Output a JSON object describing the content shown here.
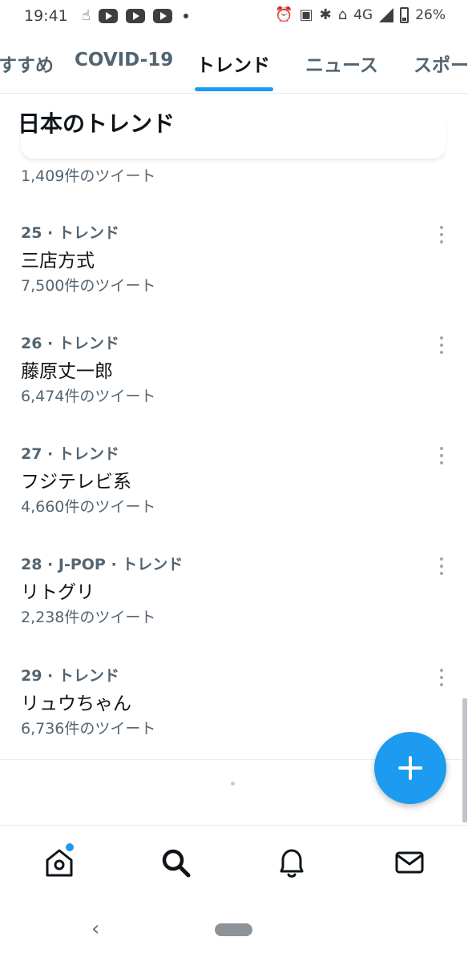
{
  "status_bar": {
    "time": "19:41",
    "network": "4G",
    "battery": "26%",
    "icons": [
      "hand-icon",
      "youtube-icon",
      "youtube-icon",
      "youtube-icon",
      "dot-icon",
      "alarm-icon",
      "nfc-icon",
      "bluetooth-icon",
      "vibrate-icon",
      "signal-icon",
      "battery-icon"
    ]
  },
  "tabs": [
    {
      "label": "すすめ"
    },
    {
      "label": "COVID-19"
    },
    {
      "label": "トレンド",
      "active": true
    },
    {
      "label": "ニュース"
    },
    {
      "label": "スポー"
    }
  ],
  "section_title": "日本のトレンド",
  "previous_item_count": "1,409件のツイート",
  "trends": [
    {
      "meta": "25 · トレンド",
      "name": "三店方式",
      "count": "7,500件のツイート"
    },
    {
      "meta": "26 · トレンド",
      "name": "藤原丈一郎",
      "count": "6,474件のツイート"
    },
    {
      "meta": "27 · トレンド",
      "name": "フジテレビ系",
      "count": "4,660件のツイート"
    },
    {
      "meta": "28 · J-POP · トレンド",
      "name": "リトグリ",
      "count": "2,238件のツイート"
    },
    {
      "meta": "29 · トレンド",
      "name": "リュウちゃん",
      "count": "6,736件のツイート"
    }
  ],
  "bottom_nav": [
    "home-icon",
    "search-icon",
    "notifications-icon",
    "messages-icon"
  ],
  "colors": {
    "accent": "#1d9bf0",
    "secondary_text": "#536471",
    "primary_text": "#0f1419"
  }
}
